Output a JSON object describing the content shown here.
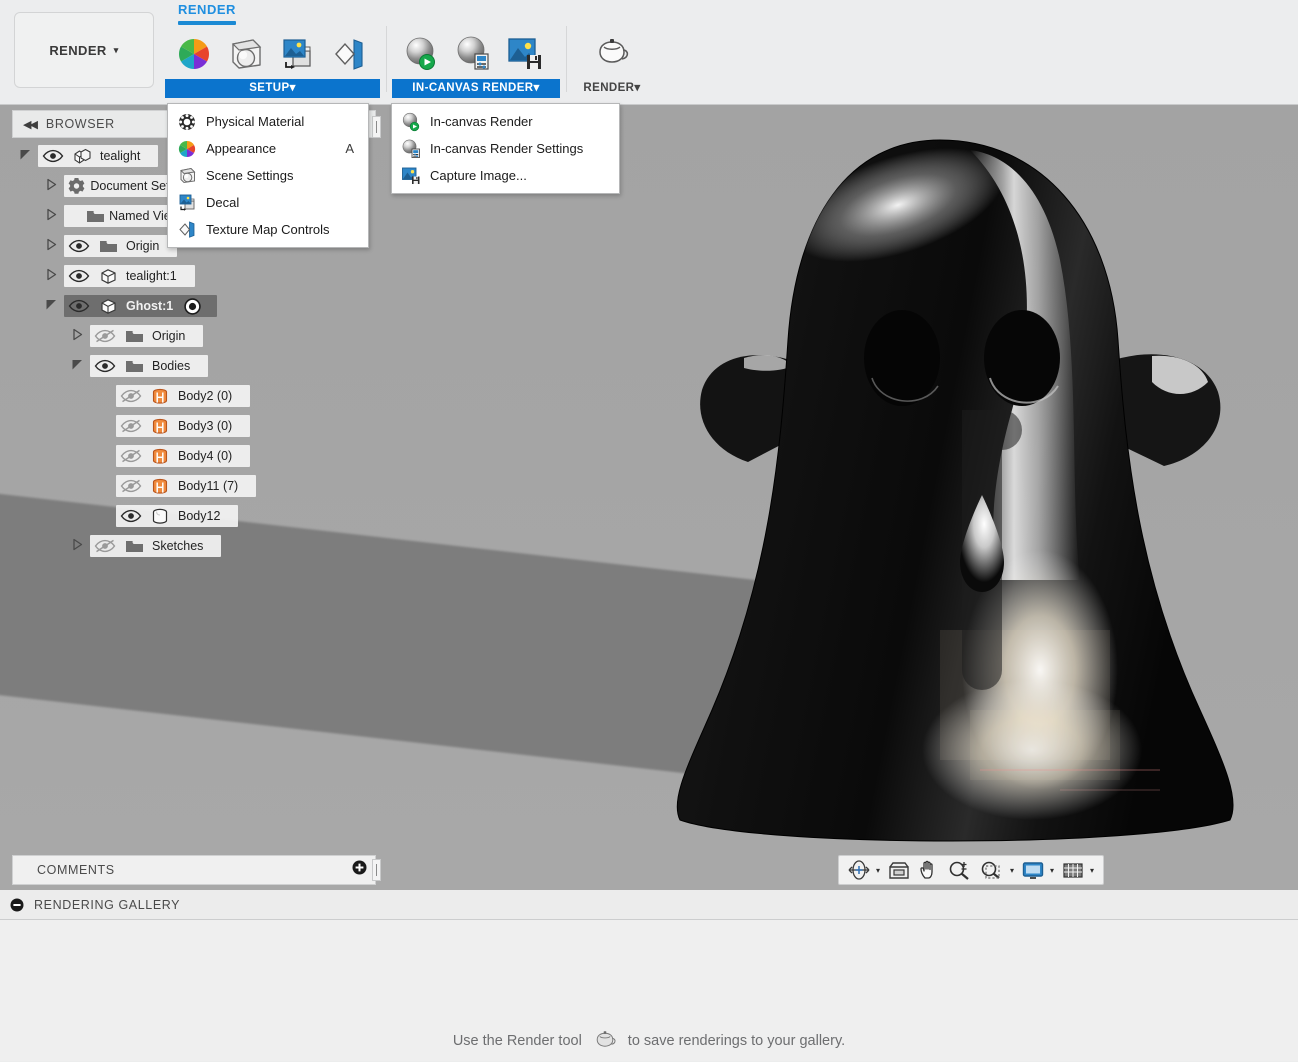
{
  "workspace": {
    "switch_label": "RENDER",
    "switch_caret": "▾"
  },
  "ribbon": {
    "tabs": [
      {
        "label": "RENDER",
        "active": true
      }
    ],
    "panels": [
      {
        "title": "SETUP",
        "title_caret": "▾",
        "active": true,
        "buttons": [
          {
            "name": "appearance-button",
            "icon": "color-wheel-icon"
          },
          {
            "name": "scene-settings-button",
            "icon": "scene-sphere-icon"
          },
          {
            "name": "decal-button",
            "icon": "decal-image-icon"
          },
          {
            "name": "texture-map-controls-button",
            "icon": "texture-map-icon"
          }
        ]
      },
      {
        "title": "IN-CANVAS RENDER",
        "title_caret": "▾",
        "active": true,
        "buttons": [
          {
            "name": "in-canvas-render-button",
            "icon": "chrome-sphere-play-icon"
          },
          {
            "name": "in-canvas-render-settings-button",
            "icon": "chrome-sphere-settings-icon"
          },
          {
            "name": "capture-image-button",
            "icon": "image-save-icon"
          }
        ]
      },
      {
        "title": "RENDER",
        "title_caret": "▾",
        "active": false,
        "buttons": [
          {
            "name": "render-button",
            "icon": "teapot-icon"
          }
        ]
      }
    ]
  },
  "setup_menu": {
    "items": [
      {
        "label": "Physical Material",
        "icon": "physical-material-icon",
        "shortcut": ""
      },
      {
        "label": "Appearance",
        "icon": "appearance-color-wheel-icon",
        "shortcut": "A"
      },
      {
        "label": "Scene Settings",
        "icon": "scene-settings-icon",
        "shortcut": ""
      },
      {
        "label": "Decal",
        "icon": "decal-icon",
        "shortcut": ""
      },
      {
        "label": "Texture Map Controls",
        "icon": "texture-map-controls-icon",
        "shortcut": ""
      }
    ]
  },
  "in_canvas_menu": {
    "items": [
      {
        "label": "In-canvas Render",
        "icon": "chrome-sphere-play-icon"
      },
      {
        "label": "In-canvas Render Settings",
        "icon": "chrome-sphere-settings-icon"
      },
      {
        "label": "Capture Image...",
        "icon": "image-save-icon"
      }
    ]
  },
  "browser": {
    "title": "BROWSER",
    "collapse_icon": "collapse-left-arrows-icon",
    "tree": [
      {
        "label": "tealight",
        "indent": 0,
        "twisty": "expanded",
        "eye": "visible",
        "icon": "assembly-icon",
        "selected": false,
        "activate_dot": false
      },
      {
        "label": "Document Settings",
        "indent": 1,
        "twisty": "collapsed",
        "eye": "none",
        "icon": "gear-icon",
        "selected": false,
        "activate_dot": false
      },
      {
        "label": "Named Views",
        "indent": 1,
        "twisty": "collapsed",
        "eye": "none",
        "icon": "folder-icon",
        "selected": false,
        "activate_dot": false
      },
      {
        "label": "Origin",
        "indent": 1,
        "twisty": "collapsed",
        "eye": "visible",
        "icon": "folder-icon",
        "selected": false,
        "activate_dot": false
      },
      {
        "label": "tealight:1",
        "indent": 1,
        "twisty": "collapsed",
        "eye": "visible",
        "icon": "component-icon",
        "selected": false,
        "activate_dot": false
      },
      {
        "label": "Ghost:1",
        "indent": 1,
        "twisty": "expanded",
        "eye": "visible",
        "icon": "component-icon",
        "selected": true,
        "activate_dot": true
      },
      {
        "label": "Origin",
        "indent": 2,
        "twisty": "collapsed",
        "eye": "hidden",
        "icon": "folder-icon",
        "selected": false,
        "activate_dot": false
      },
      {
        "label": "Bodies",
        "indent": 2,
        "twisty": "expanded",
        "eye": "visible",
        "icon": "folder-icon",
        "selected": false,
        "activate_dot": false
      },
      {
        "label": "Body2 (0)",
        "indent": 3,
        "twisty": "none",
        "eye": "hidden",
        "icon": "body-hidden-icon",
        "selected": false,
        "activate_dot": false
      },
      {
        "label": "Body3 (0)",
        "indent": 3,
        "twisty": "none",
        "eye": "hidden",
        "icon": "body-hidden-icon",
        "selected": false,
        "activate_dot": false
      },
      {
        "label": "Body4 (0)",
        "indent": 3,
        "twisty": "none",
        "eye": "hidden",
        "icon": "body-hidden-icon",
        "selected": false,
        "activate_dot": false
      },
      {
        "label": "Body11 (7)",
        "indent": 3,
        "twisty": "none",
        "eye": "hidden",
        "icon": "body-hidden-icon",
        "selected": false,
        "activate_dot": false
      },
      {
        "label": "Body12",
        "indent": 3,
        "twisty": "none",
        "eye": "visible",
        "icon": "body-visible-icon",
        "selected": false,
        "activate_dot": false
      },
      {
        "label": "Sketches",
        "indent": 2,
        "twisty": "collapsed",
        "eye": "hidden",
        "icon": "folder-icon",
        "selected": false,
        "activate_dot": false
      }
    ]
  },
  "comments": {
    "title": "COMMENTS",
    "add_icon": "add-comment-icon"
  },
  "navbar": {
    "buttons": [
      {
        "name": "orbit-button",
        "icon": "orbit-icon",
        "caret": "▾"
      },
      {
        "name": "look-at-button",
        "icon": "look-at-icon",
        "caret": ""
      },
      {
        "name": "pan-button",
        "icon": "hand-pan-icon",
        "caret": ""
      },
      {
        "name": "zoom-button",
        "icon": "zoom-magnifier-icon",
        "caret": ""
      },
      {
        "name": "fit-button",
        "icon": "zoom-window-icon",
        "caret": "▾"
      },
      {
        "name": "display-settings-button",
        "icon": "monitor-icon",
        "caret": "▾"
      },
      {
        "name": "grid-snaps-button",
        "icon": "grid-icon",
        "caret": "▾"
      }
    ]
  },
  "gallery": {
    "title": "RENDERING GALLERY",
    "collapse_icon": "minus-circle-icon",
    "hint_before": "Use the Render tool",
    "hint_icon": "teapot-icon",
    "hint_after": "to save renderings to your gallery."
  },
  "viewport": {
    "model_name": "ghost-render",
    "background_top": "#a3a3a3",
    "background_bottom": "#a8a8a8",
    "shadow_color": "#7d7d7d",
    "model_color": "#0d0d0d",
    "highlight_color": "#ffffff"
  },
  "colors": {
    "accent_blue": "#0b74cd",
    "tab_blue": "#1f8fe0",
    "panel_bg": "#ecedee",
    "selection_gray": "#6e6e6e"
  }
}
